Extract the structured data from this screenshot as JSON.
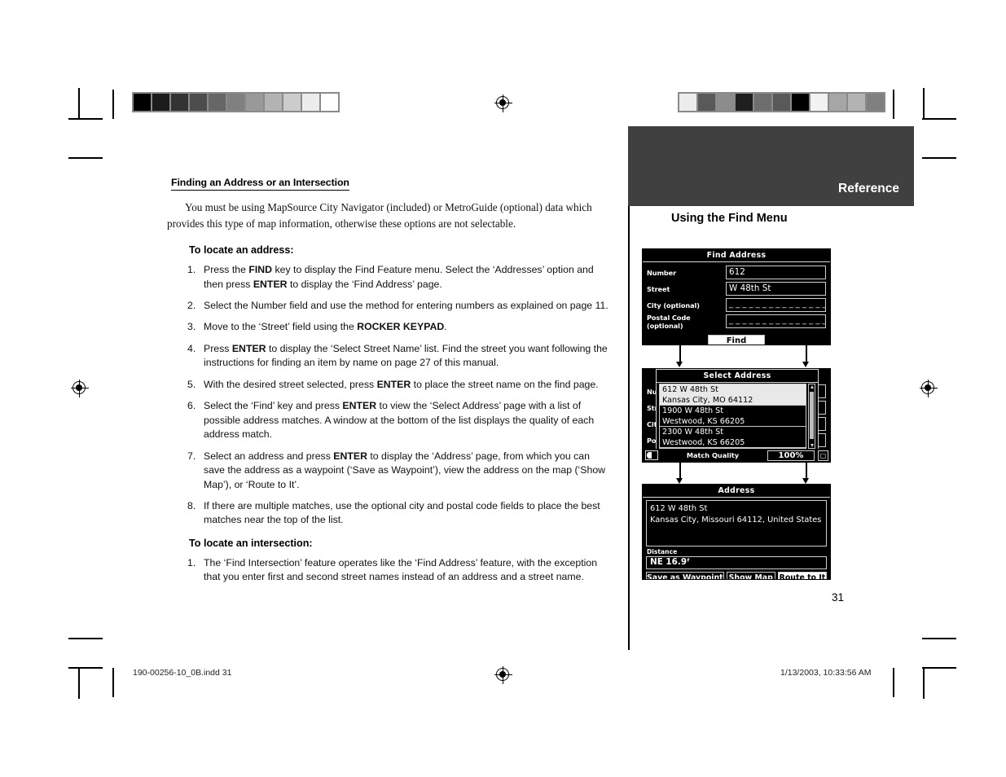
{
  "document": {
    "page_number": "31",
    "footer_left": "190-00256-10_0B.indd   31",
    "footer_right": "1/13/2003, 10:33:56 AM"
  },
  "left_column": {
    "section_heading": "Finding an Address or an Intersection",
    "intro": "You must be using MapSource City Navigator (included) or MetroGuide (optional) data which provides this type of map information, otherwise these options are not selectable.",
    "subheading_address": "To locate an address:",
    "subheading_intersection": "To locate an intersection:",
    "address_steps": [
      {
        "num": "1.",
        "parts": [
          {
            "t": "Press the ",
            "b": false
          },
          {
            "t": "FIND",
            "b": true
          },
          {
            "t": " key to display the Find Feature menu. Select the ‘Addresses’ option and then press ",
            "b": false
          },
          {
            "t": "ENTER",
            "b": true
          },
          {
            "t": " to display the ‘Find Address’ page.",
            "b": false
          }
        ]
      },
      {
        "num": "2.",
        "parts": [
          {
            "t": "Select the Number field and use the method for entering numbers as explained on page 11.",
            "b": false
          }
        ]
      },
      {
        "num": "3.",
        "parts": [
          {
            "t": "Move to the ‘Street’ field using the ",
            "b": false
          },
          {
            "t": "ROCKER KEYPAD",
            "b": true
          },
          {
            "t": ".",
            "b": false
          }
        ]
      },
      {
        "num": "4.",
        "parts": [
          {
            "t": "Press ",
            "b": false
          },
          {
            "t": "ENTER",
            "b": true
          },
          {
            "t": " to display the ‘Select Street Name’ list. Find the street you want following the instructions for finding an item by name on page 27 of this manual.",
            "b": false
          }
        ]
      },
      {
        "num": "5.",
        "parts": [
          {
            "t": "With the desired street selected, press ",
            "b": false
          },
          {
            "t": "ENTER",
            "b": true
          },
          {
            "t": " to place the street name on the find page.",
            "b": false
          }
        ]
      },
      {
        "num": "6.",
        "parts": [
          {
            "t": "Select the ‘Find’ key and press ",
            "b": false
          },
          {
            "t": "ENTER",
            "b": true
          },
          {
            "t": " to view the ‘Select Address’ page with a list of possible address matches. A window at the bottom of the list displays the quality of each address match.",
            "b": false
          }
        ]
      },
      {
        "num": "7.",
        "parts": [
          {
            "t": "Select an address and press ",
            "b": false
          },
          {
            "t": "ENTER",
            "b": true
          },
          {
            "t": " to display the ‘Address’ page, from which you can save the address as a waypoint (‘Save as Waypoint’), view the address on the map (‘Show Map’), or ‘Route to It’.",
            "b": false
          }
        ]
      },
      {
        "num": "8.",
        "parts": [
          {
            "t": "If there are multiple matches, use the optional city and postal code fields to place the best matches near the top of the list.",
            "b": false
          }
        ]
      }
    ],
    "intersection_steps": [
      {
        "num": "1.",
        "parts": [
          {
            "t": "The ‘Find Intersection’ feature operates like the ‘Find Address’ feature, with the exception that you enter first and second street names instead of an address and a street name.",
            "b": false
          }
        ]
      }
    ]
  },
  "right_column": {
    "banner_label": "Reference",
    "banner_color": "#404040",
    "section_title": "Using the Find Menu"
  },
  "screens": {
    "find_address": {
      "title": "Find Address",
      "fields": [
        {
          "label": "Number",
          "value": "612",
          "blank": false
        },
        {
          "label": "Street",
          "value": "W 48th St",
          "blank": false
        },
        {
          "label": "City (optional)",
          "value": "_ _ _ _ _ _ _ _ _ _ _ _ _ _ _ _",
          "blank": true
        },
        {
          "label": "Postal Code (optional)",
          "value": "_ _ _ _ _ _ _ _ _ _ _ _ _ _ _ _",
          "blank": true
        }
      ],
      "find_button": "Find"
    },
    "select_address": {
      "title": "Select Address",
      "background_labels": [
        "Num",
        "Stre",
        "City",
        "Post"
      ],
      "list": [
        {
          "line1": "612 W 48th St",
          "line2": "Kansas City, MO 64112",
          "selected": true
        },
        {
          "line1": "1900 W 48th St",
          "line2": "Westwood, KS 66205",
          "selected": false
        },
        {
          "line1": "2300 W 48th St",
          "line2": "Westwood, KS 66205",
          "selected": false
        }
      ],
      "match_quality_label": "Match Quality",
      "match_quality_value": "100%",
      "battery_icon": "battery-icon",
      "corner_icon": "page-icon"
    },
    "address": {
      "title": "Address",
      "line1": "612 W 48th St",
      "line2": "Kansas City, Missouri 64112, United States",
      "distance_label": "Distance",
      "distance_value": "NE    16.9ᶠ",
      "buttons": [
        {
          "label": "Save as Waypoint",
          "active": false
        },
        {
          "label": "Show Map",
          "active": false
        },
        {
          "label": "Route to It",
          "active": true
        }
      ]
    }
  },
  "calibration": {
    "left_strip": [
      "#000000",
      "#1c1c1c",
      "#333333",
      "#4d4d4d",
      "#666666",
      "#808080",
      "#999999",
      "#b3b3b3",
      "#cccccc",
      "#ececec",
      "#ffffff"
    ],
    "right_strip": [
      "#ececec",
      "#595959",
      "#8c8c8c",
      "#1f1f1f",
      "#6e6e6e",
      "#595959",
      "#000000",
      "#f2f2f2",
      "#a6a6a6",
      "#b3b3b3",
      "#808080"
    ]
  }
}
